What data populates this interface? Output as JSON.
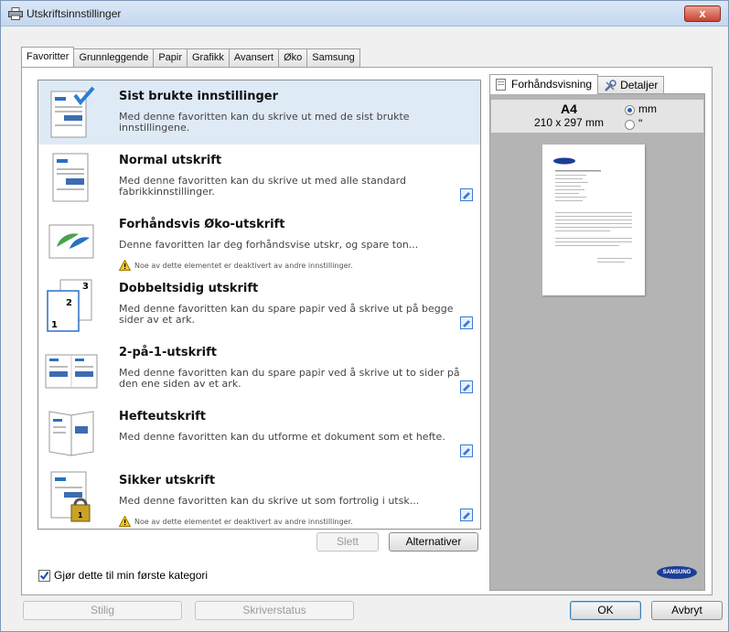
{
  "window": {
    "title": "Utskriftsinnstillinger",
    "close_label": "x"
  },
  "tabs": [
    {
      "label": "Favoritter",
      "active": true
    },
    {
      "label": "Grunnleggende"
    },
    {
      "label": "Papir"
    },
    {
      "label": "Grafikk"
    },
    {
      "label": "Avansert"
    },
    {
      "label": "Øko"
    },
    {
      "label": "Samsung"
    }
  ],
  "favorites": [
    {
      "title": "Sist brukte innstillinger",
      "description": "Med denne favoritten kan du skrive ut med de sist brukte innstillingene.",
      "icon": "recent-settings-icon",
      "selected": true,
      "editable": false
    },
    {
      "title": "Normal utskrift",
      "description": "Med denne favoritten kan du skrive ut med alle standard fabrikkinnstillinger.",
      "icon": "normal-print-icon",
      "editable": true
    },
    {
      "title": "Forhåndsvis Øko-utskrift",
      "description": "Denne favoritten lar deg forhåndsvise utskr, og spare ton...",
      "warning": "Noe av dette elementet er deaktivert av andre innstillinger.",
      "icon": "eco-preview-icon",
      "editable": false
    },
    {
      "title": "Dobbeltsidig utskrift",
      "description": "Med denne favoritten kan du spare papir ved å skrive ut på begge sider av et ark.",
      "icon": "duplex-print-icon",
      "editable": true
    },
    {
      "title": "2-på-1-utskrift",
      "description": "Med denne favoritten kan du spare papir ved å skrive ut to sider på den ene siden av et ark.",
      "icon": "two-up-print-icon",
      "editable": true
    },
    {
      "title": "Hefteutskrift",
      "description": "Med denne favoritten kan du utforme et dokument som et hefte.",
      "icon": "booklet-print-icon",
      "editable": true
    },
    {
      "title": "Sikker utskrift",
      "description": "Med denne favoritten kan du skrive ut som fortrolig i utsk...",
      "warning": "Noe av dette elementet er deaktivert av andre innstillinger.",
      "icon": "secure-print-icon",
      "editable": true
    }
  ],
  "list_buttons": {
    "delete": "Slett",
    "options": "Alternativer"
  },
  "checkbox": {
    "label": "Gjør dette til min første kategori",
    "checked": true
  },
  "preview": {
    "tabs": [
      {
        "label": "Forhåndsvisning",
        "active": true
      },
      {
        "label": "Detaljer"
      }
    ],
    "paper_size": "A4",
    "paper_dims": "210 x 297 mm",
    "units": [
      {
        "label": "mm",
        "selected": true
      },
      {
        "label": "\"",
        "selected": false
      }
    ],
    "brand_logo_text": "SAMSUNG"
  },
  "footer": {
    "style_button": "Stilig",
    "printer_status_button": "Skriverstatus",
    "ok": "OK",
    "cancel": "Avbryt"
  },
  "colors": {
    "selected_row": "#dfeaf7",
    "accent": "#1c3e94",
    "window_bg": "#f0f0f0"
  }
}
